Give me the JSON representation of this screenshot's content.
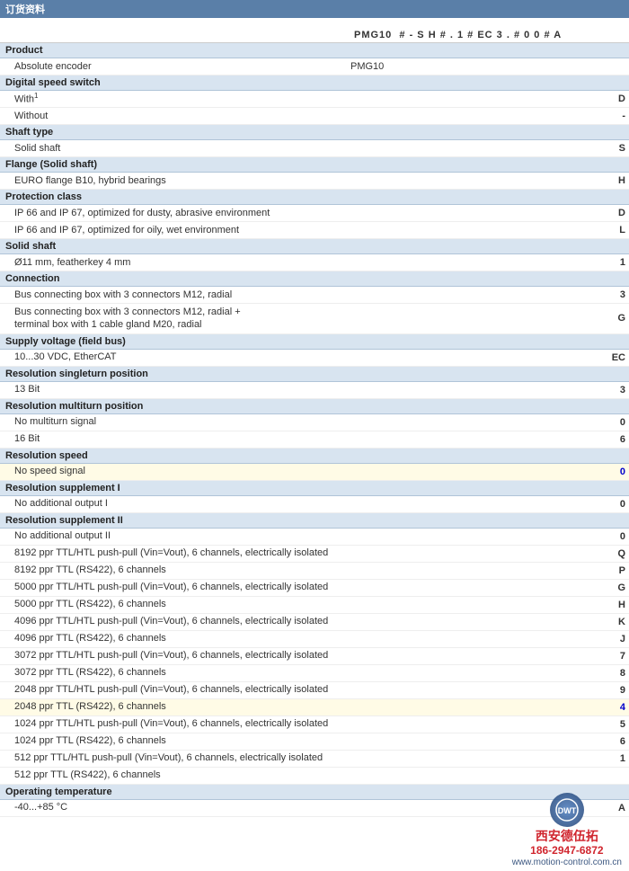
{
  "topBar": {
    "label": "订货资料"
  },
  "columnHeader": {
    "product": "PMG10",
    "codes": [
      "P",
      "M",
      "G",
      "1",
      "0",
      " ",
      "#",
      " ",
      "-",
      " ",
      "S",
      " ",
      "H",
      " ",
      "#",
      " ",
      ".",
      " ",
      "1",
      " ",
      "#",
      " ",
      "E",
      "C",
      " ",
      "3",
      " ",
      ".",
      " ",
      "#",
      " ",
      "0",
      " ",
      "0",
      " ",
      "#",
      " ",
      "A"
    ]
  },
  "sections": [
    {
      "id": "product",
      "header": "Product",
      "rows": [
        {
          "label": "Absolute encoder",
          "value": "PMG10",
          "valuePos": 0
        }
      ]
    },
    {
      "id": "digital-speed-switch",
      "header": "Digital speed switch",
      "rows": [
        {
          "label": "With(1)",
          "sup": "1",
          "value": "D",
          "valuePos": 220
        },
        {
          "label": "Without",
          "value": "-",
          "valuePos": 220
        }
      ]
    },
    {
      "id": "shaft-type",
      "header": "Shaft type",
      "rows": [
        {
          "label": "Solid shaft",
          "value": "S",
          "valuePos": 245
        }
      ]
    },
    {
      "id": "flange",
      "header": "Flange (Solid shaft)",
      "rows": [
        {
          "label": "EURO flange B10, hybrid bearings",
          "value": "H",
          "valuePos": 265
        }
      ]
    },
    {
      "id": "protection-class",
      "header": "Protection class",
      "rows": [
        {
          "label": "IP 66 and IP 67, optimized for dusty, abrasive environment",
          "value": "D",
          "valuePos": 220
        },
        {
          "label": "IP 66 and IP 67, optimized for oily, wet environment",
          "value": "L",
          "valuePos": 220
        }
      ]
    },
    {
      "id": "solid-shaft",
      "header": "Solid shaft",
      "rows": [
        {
          "label": "Ø11 mm, featherkey 4 mm",
          "value": "1",
          "valuePos": 290
        }
      ]
    },
    {
      "id": "connection",
      "header": "Connection",
      "rows": [
        {
          "label": "Bus connecting box with 3 connectors M12, radial",
          "value": "3",
          "valuePos": 310
        },
        {
          "label": "Bus connecting box with 3 connectors M12, radial +\nterminal box with 1 cable gland M20, radial",
          "value": "G",
          "valuePos": 310,
          "multiline": true
        }
      ]
    },
    {
      "id": "supply-voltage",
      "header": "Supply voltage (field bus)",
      "rows": [
        {
          "label": "10...30 VDC, EtherCAT",
          "value": "EC",
          "valuePos": 330
        }
      ]
    },
    {
      "id": "resolution-singleturn",
      "header": "Resolution singleturn position",
      "rows": [
        {
          "label": "13 Bit",
          "value": "3",
          "valuePos": 365
        }
      ]
    },
    {
      "id": "resolution-multiturn",
      "header": "Resolution multiturn position",
      "rows": [
        {
          "label": "No multiturn signal",
          "value": "0",
          "valuePos": 385
        },
        {
          "label": "16 Bit",
          "value": "6",
          "valuePos": 385
        }
      ]
    },
    {
      "id": "resolution-speed",
      "header": "Resolution speed",
      "rows": [
        {
          "label": "No speed signal",
          "value": "0",
          "valuePos": 405,
          "highlight": true
        }
      ]
    },
    {
      "id": "resolution-supplement-1",
      "header": "Resolution supplement I",
      "rows": [
        {
          "label": "No additional output I",
          "value": "0",
          "valuePos": 425
        }
      ]
    },
    {
      "id": "resolution-supplement-2",
      "header": "Resolution supplement II",
      "rows": [
        {
          "label": "No additional output II",
          "value": "0",
          "valuePos": 445
        },
        {
          "label": "8192 ppr TTL/HTL push-pull (Vin=Vout), 6 channels, electrically isolated",
          "value": "Q",
          "valuePos": 445
        },
        {
          "label": "8192 ppr TTL (RS422), 6 channels",
          "value": "P",
          "valuePos": 445
        },
        {
          "label": "5000 ppr TTL/HTL push-pull (Vin=Vout), 6 channels, electrically isolated",
          "value": "G",
          "valuePos": 445
        },
        {
          "label": "5000 ppr TTL (RS422), 6 channels",
          "value": "H",
          "valuePos": 445
        },
        {
          "label": "4096 ppr TTL/HTL push-pull (Vin=Vout), 6 channels, electrically isolated",
          "value": "K",
          "valuePos": 445
        },
        {
          "label": "4096 ppr TTL (RS422), 6 channels",
          "value": "J",
          "valuePos": 445
        },
        {
          "label": "3072 ppr TTL/HTL push-pull (Vin=Vout), 6 channels, electrically isolated",
          "value": "7",
          "valuePos": 445
        },
        {
          "label": "3072 ppr TTL (RS422), 6 channels",
          "value": "8",
          "valuePos": 445
        },
        {
          "label": "2048 ppr TTL/HTL push-pull (Vin=Vout), 6 channels, electrically isolated",
          "value": "9",
          "valuePos": 445
        },
        {
          "label": "2048 ppr TTL (RS422), 6 channels",
          "value": "4",
          "valuePos": 445,
          "highlight": true
        },
        {
          "label": "1024 ppr TTL/HTL push-pull (Vin=Vout), 6 channels, electrically isolated",
          "value": "5",
          "valuePos": 445
        },
        {
          "label": "1024 ppr TTL (RS422), 6 channels",
          "value": "6",
          "valuePos": 445
        },
        {
          "label": "512 ppr TTL/HTL push-pull (Vin=Vout), 6 channels, electrically isolated",
          "value": "1",
          "valuePos": 445
        },
        {
          "label": "512 ppr TTL (RS422), 6 channels",
          "value": "",
          "valuePos": 445
        }
      ]
    },
    {
      "id": "operating-temp",
      "header": "Operating temperature",
      "rows": [
        {
          "label": "-40...+85 °C",
          "value": "A",
          "valuePos": 460
        }
      ]
    }
  ],
  "watermark": {
    "company": "西安德伍拓",
    "phone": "186-2947-6872",
    "url": "www.motion-control.com.cn"
  }
}
